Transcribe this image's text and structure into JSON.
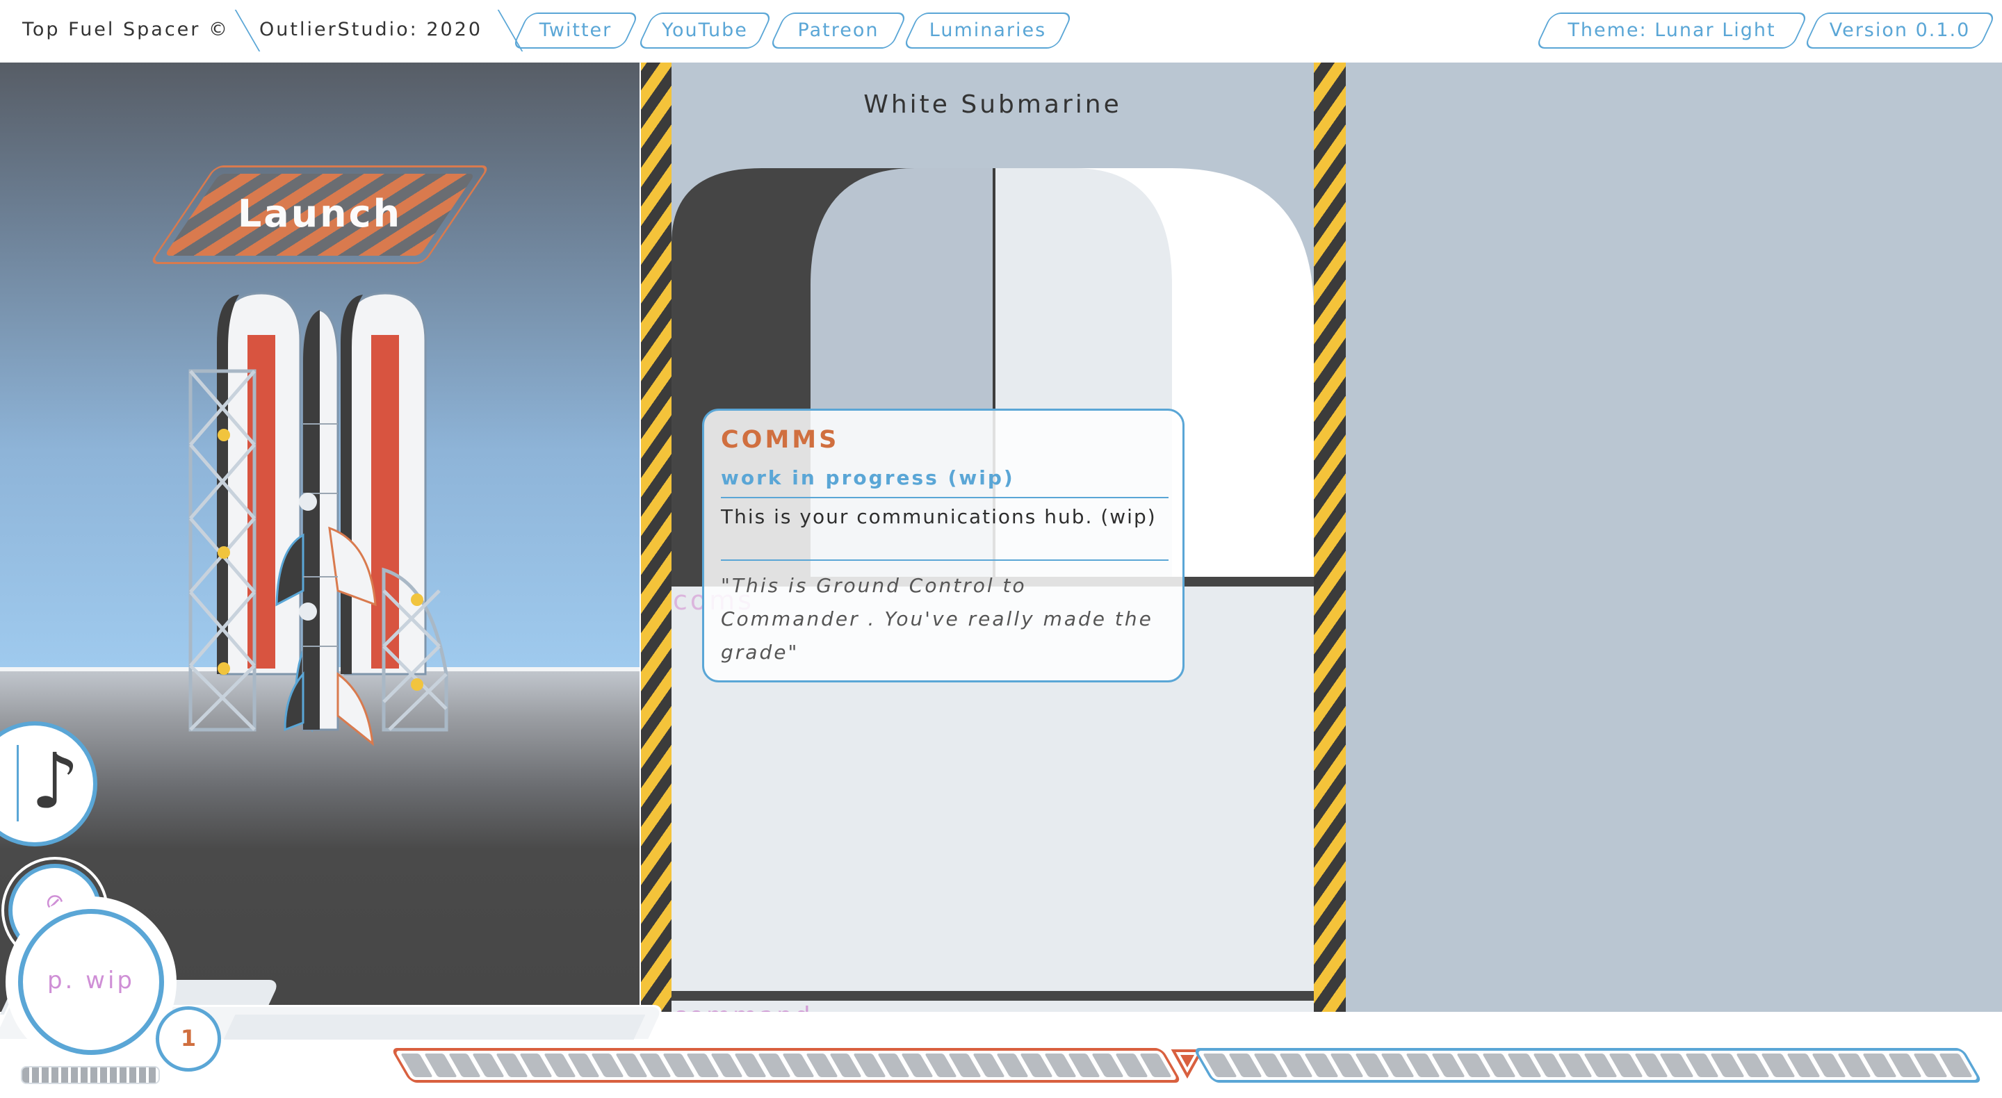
{
  "topbar": {
    "brand_title": "Top Fuel Spacer ©",
    "studio": "OutlierStudio: 2020",
    "links": [
      "Twitter",
      "YouTube",
      "Patreon",
      "Luminaries"
    ],
    "theme": "Theme: Lunar Light",
    "version": "Version 0.1.0"
  },
  "launch_panel": {
    "launch_label": "Launch"
  },
  "submarine": {
    "title": "White Submarine",
    "ghost_coms": "coms",
    "ghost_command": "command"
  },
  "comms": {
    "title": "COMMS",
    "subtitle": "work in progress (wip)",
    "description": "This is your communications hub. (wip)",
    "quote": "\"This is Ground Control to Commander . You've really made the grade\""
  },
  "widgets": {
    "music_icon": "music-note-icon",
    "music_glyph": "♪",
    "small_icon": "no-sign-icon",
    "small_glyph": "⊘",
    "profile_label": "p. wip",
    "count": "1"
  },
  "colors": {
    "accent_blue": "#5aa6d6",
    "accent_orange": "#d06f3f",
    "hazard_yellow": "#f4c33a",
    "panel_grey": "#bac6d2",
    "ghost_purple": "#cf8fd6"
  },
  "gauges": {
    "fuel_level": 0,
    "secondary_level": 0
  }
}
